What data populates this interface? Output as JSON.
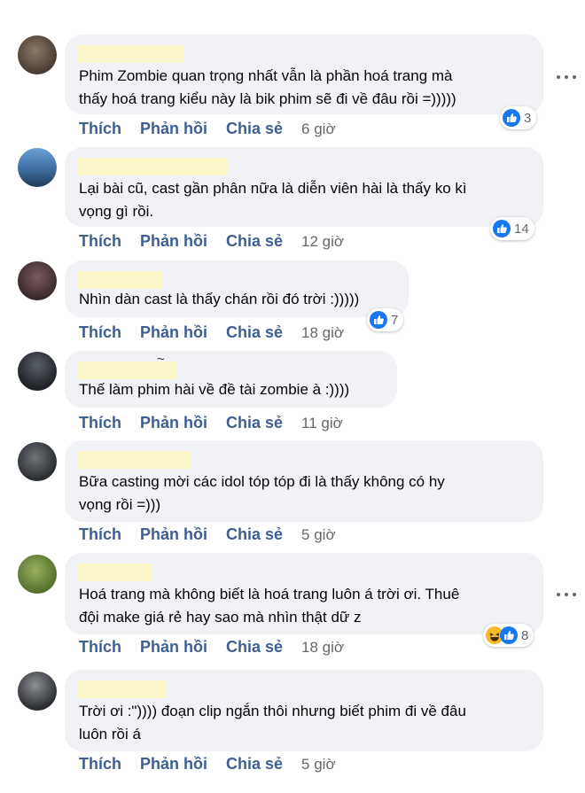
{
  "actions": {
    "like": "Thích",
    "reply": "Phản hồi",
    "share": "Chia sẻ"
  },
  "colors": {
    "accent": "#3e5f93",
    "bubble": "#f0f2f5",
    "name_redaction": "#fbf6c9",
    "like_blue": "#1877f2",
    "haha_yellow": "#f7b928"
  },
  "comments": [
    {
      "text": "Phim Zombie quan trọng nhất vẫn là phần hoá trang mà\nthấy hoá trang kiểu này là bik phim sẽ đi về đâu rồi =)))))",
      "reaction_count": "3",
      "time": "6 giờ",
      "reactions": [
        "like"
      ]
    },
    {
      "text": "Lại bài cũ, cast gần phân nữa là diễn viên hài là thấy ko kì\nvọng gì rồi.",
      "reaction_count": "14",
      "time": "12 giờ",
      "reactions": [
        "like"
      ]
    },
    {
      "text": "Nhìn dàn cast là thấy chán rồi đó trời :)))))",
      "reaction_count": "7",
      "time": "18 giờ",
      "reactions": [
        "like"
      ]
    },
    {
      "text": "Thế làm phim hài về đề tài zombie à :))))",
      "name_glyph": "~",
      "time": "11 giờ",
      "reactions": []
    },
    {
      "text": "Bữa casting mời các idol tóp tóp đi là thấy không có hy\nvọng rồi =)))",
      "time": "5 giờ",
      "reactions": []
    },
    {
      "text": "Hoá trang mà không biết là hoá trang luôn á trời ơi. Thuê\nđội make giá rẻ hay sao mà nhìn thật dữ z",
      "reaction_count": "8",
      "time": "18 giờ",
      "reactions": [
        "haha",
        "like"
      ]
    },
    {
      "text": "Trời ơi :\")))) đoạn clip ngắn thôi nhưng biết phim đi về đâu\nluôn rồi á",
      "time": "5 giờ",
      "reactions": []
    }
  ]
}
